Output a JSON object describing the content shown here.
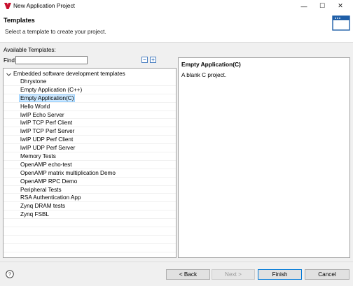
{
  "window": {
    "title": "New Application Project",
    "minimize_glyph": "—",
    "maximize_glyph": "☐",
    "close_glyph": "✕",
    "logo_icon": "xilinx-logo-icon",
    "logo_color": "#c8102e"
  },
  "banner": {
    "title": "Templates",
    "description": "Select a template to create your project.",
    "icon": "window-icon",
    "icon_color": "#1f5fa8"
  },
  "filter": {
    "available_label": "Available Templates:",
    "find_label": "Find:",
    "find_value": "",
    "collapse_icon": "collapse-all-icon",
    "expand_icon": "expand-all-icon"
  },
  "tree": {
    "root_label": "Embedded software development templates",
    "selected": "Empty Application(C)",
    "items": [
      {
        "label": "Dhrystone"
      },
      {
        "label": "Empty Application (C++)"
      },
      {
        "label": "Empty Application(C)"
      },
      {
        "label": "Hello World"
      },
      {
        "label": "lwIP Echo Server"
      },
      {
        "label": "lwIP TCP Perf Client"
      },
      {
        "label": "lwIP TCP Perf Server"
      },
      {
        "label": "lwIP UDP Perf Client"
      },
      {
        "label": "lwIP UDP Perf Server"
      },
      {
        "label": "Memory Tests"
      },
      {
        "label": "OpenAMP echo-test"
      },
      {
        "label": "OpenAMP matrix multiplication Demo"
      },
      {
        "label": "OpenAMP RPC Demo"
      },
      {
        "label": "Peripheral Tests"
      },
      {
        "label": "RSA Authentication App"
      },
      {
        "label": "Zynq DRAM tests"
      },
      {
        "label": "Zynq FSBL"
      }
    ],
    "empty_rows": 5,
    "selection_color": "#cce8ff"
  },
  "detail": {
    "title": "Empty Application(C)",
    "description": "A blank C project."
  },
  "footer": {
    "help_glyph": "?",
    "back_label": "< Back",
    "next_label": "Next >",
    "finish_label": "Finish",
    "cancel_label": "Cancel"
  }
}
